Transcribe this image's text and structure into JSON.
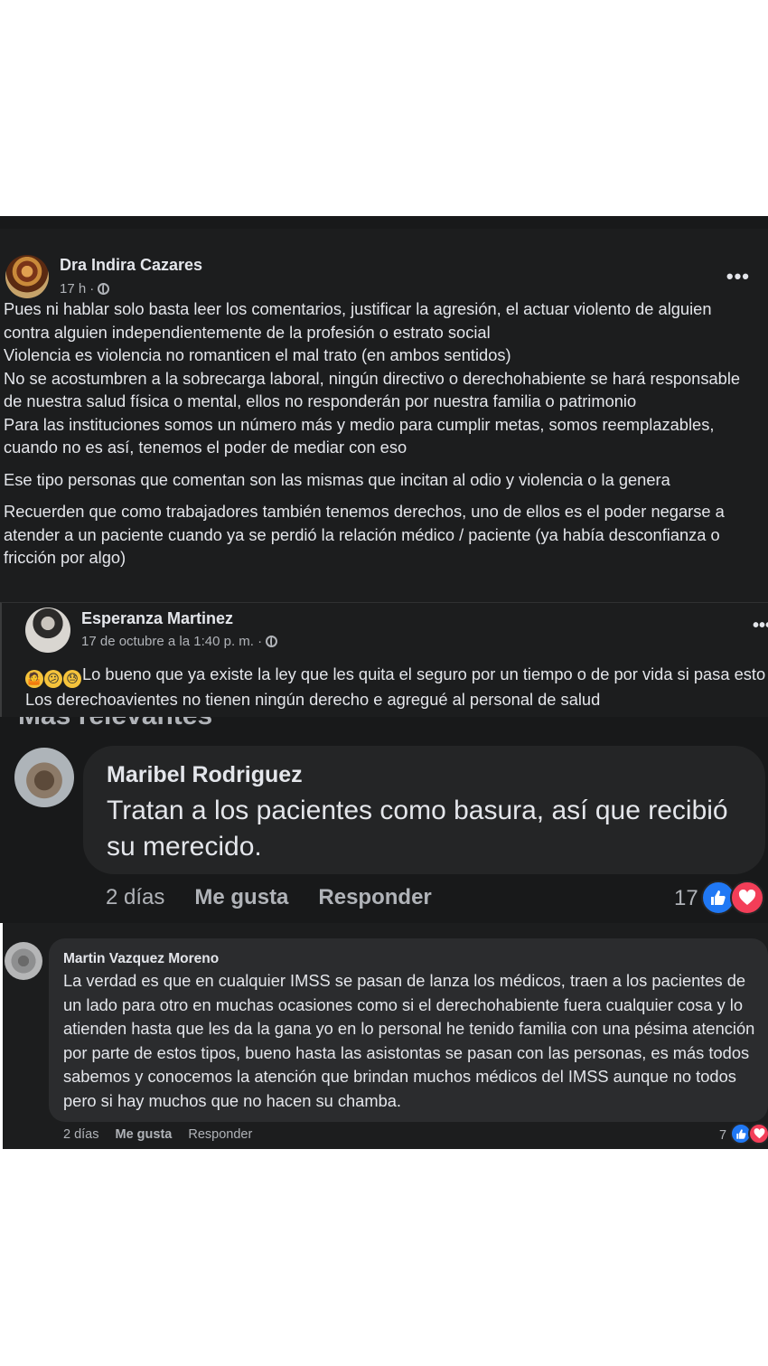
{
  "post": {
    "author": "Dra Indira Cazares",
    "time": "17 h",
    "privacy_icon": "globe-icon",
    "more_icon": "more-options-icon",
    "more_label": "•••",
    "paragraphs": [
      "Pues ni hablar solo basta leer los comentarios, justificar la agresión, el actuar violento de alguien contra alguien independientemente de la profesión o estrato social\nViolencia es violencia no romanticen el mal trato (en ambos sentidos)\nNo se acostumbren a la sobrecarga laboral, ningún directivo o derechohabiente se hará responsable de nuestra salud física o mental, ellos no responderán por nuestra familia o patrimonio\nPara las instituciones somos un número más y medio para cumplir metas, somos reemplazables, cuando no es así, tenemos el poder de mediar con eso",
      "Ese tipo personas que comentan son las mismas que incitan al odio y violencia o la genera",
      "Recuerden que como trabajadores también tenemos derechos, uno de ellos es el poder negarse a atender a un paciente cuando ya se perdió la relación médico / paciente (ya había desconfianza o fricción por algo)"
    ]
  },
  "comment_esperanza": {
    "author": "Esperanza Martinez",
    "time": "17 de octubre a la 1:40 p. m. ·",
    "emojis": [
      "🤷",
      "😕",
      "😓"
    ],
    "text": "Lo bueno que ya existe la ley que les quita el seguro por un tiempo o de por vida si pasa esto Los derechoavientes no tienen ningún derecho e agregué al personal de salud",
    "more_label": "•••"
  },
  "comment_maribel": {
    "cut_header": "Más relevantes",
    "author": "Maribel Rodriguez",
    "text": "Tratan a los pacientes como basura, así que recibió su merecido.",
    "time": "2 días",
    "like_label": "Me gusta",
    "reply_label": "Responder",
    "reaction_count": "17",
    "reactions": [
      "like-icon",
      "love-icon"
    ]
  },
  "comment_martin": {
    "author": "Martin Vazquez Moreno",
    "text": "La verdad es que en cualquier IMSS se pasan de lanza los médicos, traen a los pacientes de un lado para otro en muchas ocasiones como si el derechohabiente fuera cualquier cosa y lo atienden hasta que les da la gana yo en lo personal he tenido familia con una pésima atención por parte de estos tipos, bueno hasta las asistontas se pasan con las personas, es más todos sabemos y conocemos la atención que brindan muchos médicos del IMSS aunque no todos pero si hay muchos que no hacen su chamba.",
    "time": "2 días",
    "like_label": "Me gusta",
    "reply_label": "Responder",
    "reaction_count": "7",
    "reactions": [
      "like-icon",
      "love-icon"
    ]
  },
  "colors": {
    "background": "#242526",
    "text": "#e4e6eb",
    "secondary_text": "#b0b3b8",
    "like_blue": "#2078f4",
    "love_red": "#f33e58"
  }
}
